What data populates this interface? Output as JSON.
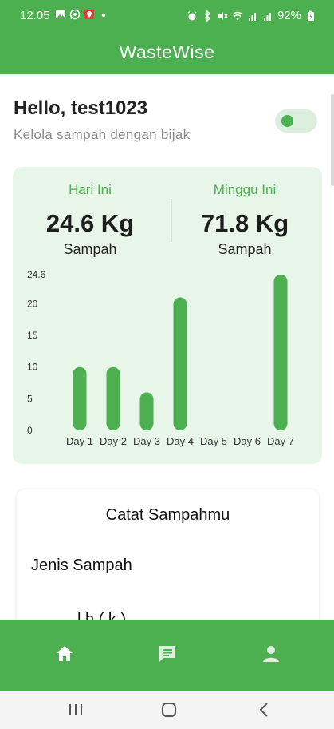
{
  "status_bar": {
    "time": "12.05",
    "battery": "92%",
    "left_icons": [
      "image-icon",
      "whatsapp-icon",
      "app-badge-icon",
      "dot-icon"
    ],
    "right_icons": [
      "alarm-icon",
      "bluetooth-icon",
      "mute-icon",
      "wifi-icon",
      "signal-icon",
      "signal-icon",
      "battery-icon"
    ]
  },
  "app_bar": {
    "title": "WasteWise"
  },
  "greeting": {
    "title": "Hello, test1023",
    "subtitle": "Kelola sampah dengan bijak"
  },
  "theme_toggle": {
    "state": "on"
  },
  "summary": {
    "today": {
      "label": "Hari Ini",
      "value": "24.6 Kg",
      "unit": "Sampah"
    },
    "week": {
      "label": "Minggu Ini",
      "value": "71.8 Kg",
      "unit": "Sampah"
    }
  },
  "chart_data": {
    "type": "bar",
    "categories": [
      "Day 1",
      "Day 2",
      "Day 3",
      "Day 4",
      "Day 5",
      "Day 6",
      "Day 7"
    ],
    "values": [
      10,
      10,
      6,
      21,
      0,
      0,
      24.6
    ],
    "ylim": [
      0,
      24.6
    ],
    "yticks": [
      "0",
      "5",
      "10",
      "15",
      "20",
      "24.6"
    ],
    "grid": false,
    "bar_color": "#4caf50",
    "title": "",
    "xlabel": "",
    "ylabel": ""
  },
  "form": {
    "title": "Catat Sampahmu",
    "field_label": "Jenis Sampah",
    "next_label_partial": "l  h    (  k )"
  },
  "bottom_nav": {
    "items": [
      "home-icon",
      "chat-icon",
      "profile-icon"
    ],
    "active": "home-icon"
  },
  "system_nav": {
    "items": [
      "recent-apps-icon",
      "home-button-icon",
      "back-icon"
    ]
  },
  "colors": {
    "primary": "#4caf50",
    "card_bg": "#e8f5e9",
    "text_dark": "#222222",
    "text_muted": "#8a8a8a"
  }
}
